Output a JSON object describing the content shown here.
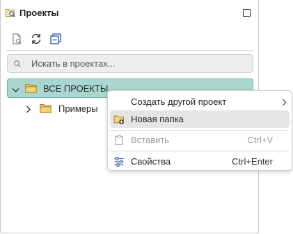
{
  "header": {
    "title": "Проекты"
  },
  "search": {
    "placeholder": "Искать в проектах..."
  },
  "tree": {
    "root_label": "ВСЕ ПРОЕКТЫ",
    "child_label": "Примеры"
  },
  "context_menu": {
    "items": [
      {
        "label": "Создать другой проект",
        "shortcut": "",
        "icon": "none",
        "submenu": true
      },
      {
        "label": "Новая папка",
        "shortcut": "",
        "icon": "new-folder-icon",
        "state": "hover"
      },
      {
        "label": "Вставить",
        "shortcut": "Ctrl+V",
        "icon": "clipboard-icon",
        "state": "disabled"
      },
      {
        "label": "Свойства",
        "shortcut": "Ctrl+Enter",
        "icon": "sliders-icon"
      }
    ]
  },
  "colors": {
    "selection_bg": "#a9d6cf",
    "selection_border": "#6cb4a9",
    "folder": "#e9c46a",
    "accent_blue": "#2f5fb3"
  }
}
